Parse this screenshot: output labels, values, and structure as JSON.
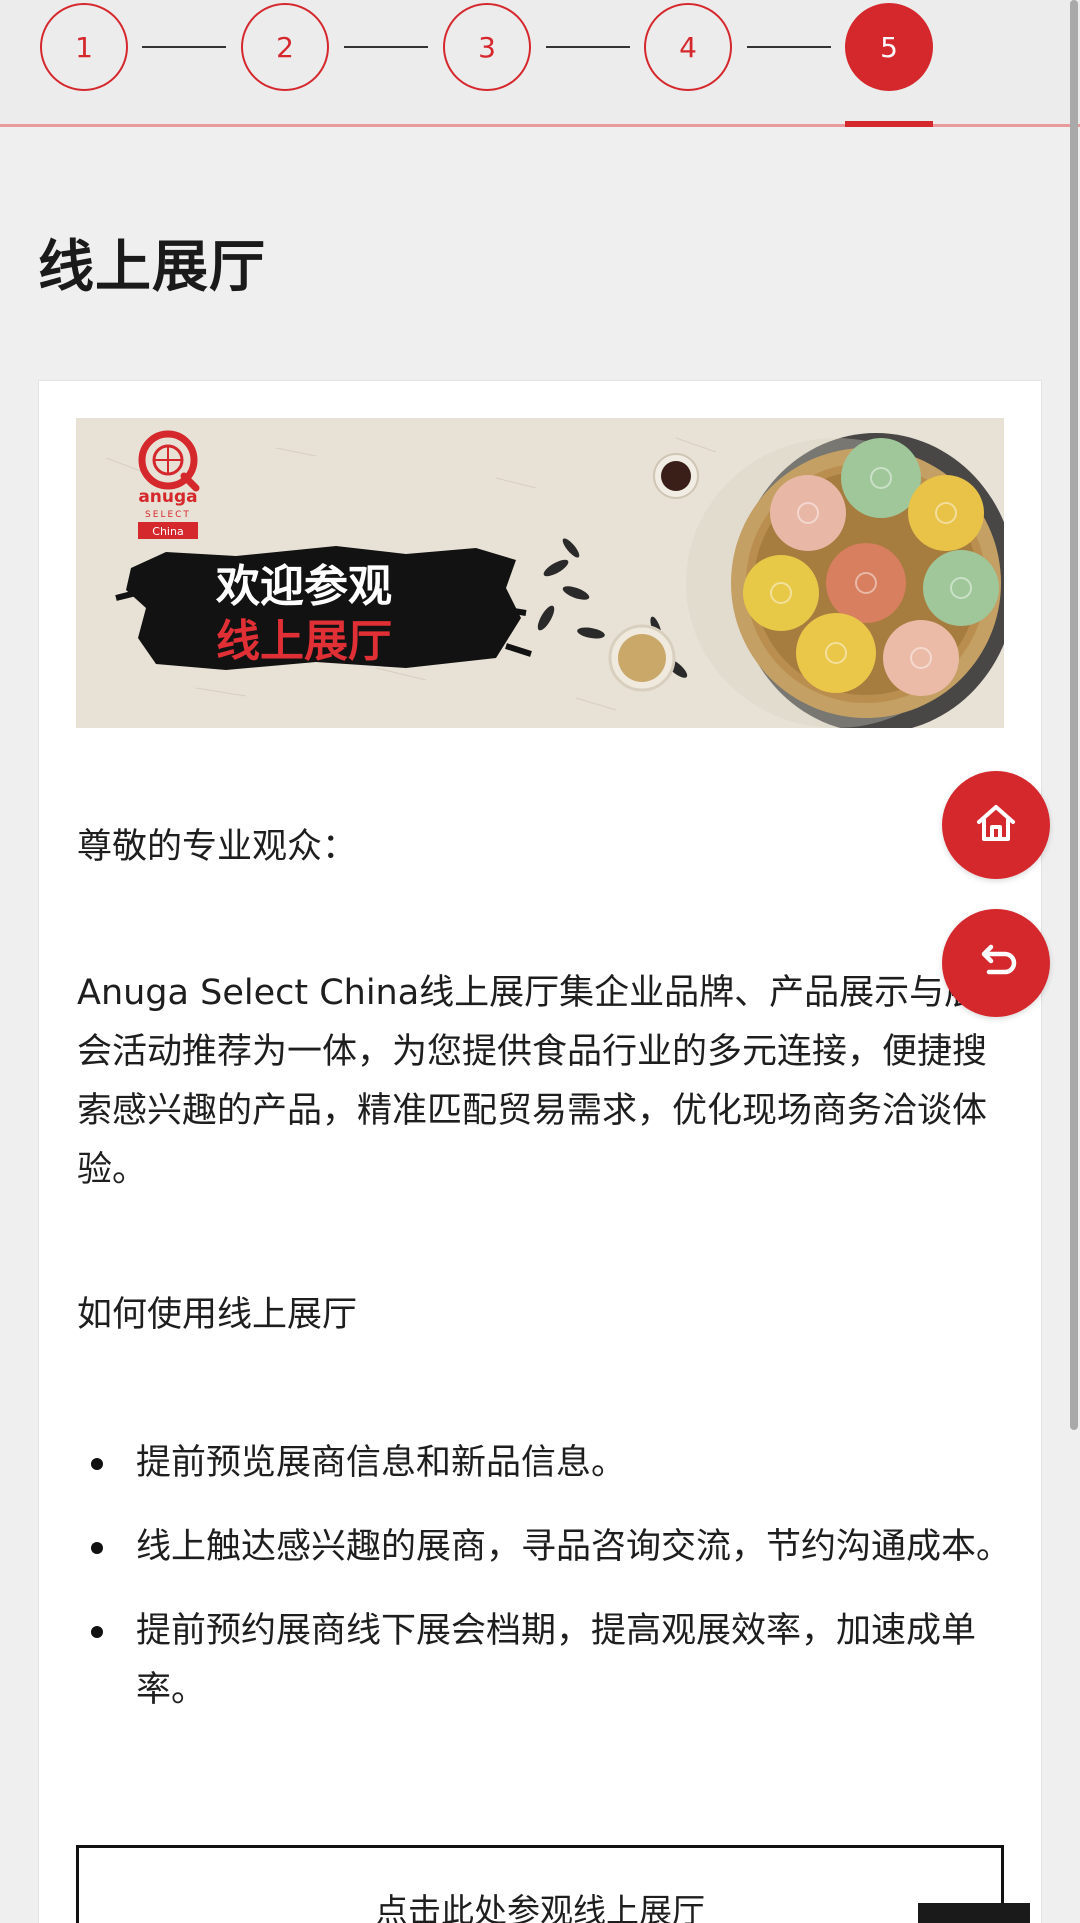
{
  "stepper": {
    "steps": [
      "1",
      "2",
      "3",
      "4",
      "5"
    ],
    "active_step": 5
  },
  "page": {
    "title": "线上展厅"
  },
  "banner": {
    "logo_text": "anuga",
    "logo_sub": "SELECT",
    "logo_tag": "China",
    "headline_line1": "欢迎参观",
    "headline_line2": "线上展厅"
  },
  "content": {
    "greeting": "尊敬的专业观众：",
    "intro": "Anuga Select China线上展厅集企业品牌、产品展示与展会活动推荐为一体，为您提供食品行业的多元连接，便捷搜索感兴趣的产品，精准匹配贸易需求，优化现场商务洽谈体验。",
    "howto_heading": "如何使用线上展厅",
    "bullets": [
      "提前预览展商信息和新品信息。",
      "线上触达感兴趣的展商，寻品咨询交流，节约沟通成本。",
      "提前预约展商线下展会档期，提高观展效率，加速成单率。"
    ],
    "cta_label": "点击此处参观线上展厅"
  },
  "fab": {
    "home_icon": "home-icon",
    "back_icon": "back-arrow-icon"
  },
  "colors": {
    "accent": "#d5282d",
    "background": "#efefef",
    "card": "#ffffff",
    "text": "#1e1e1e"
  }
}
